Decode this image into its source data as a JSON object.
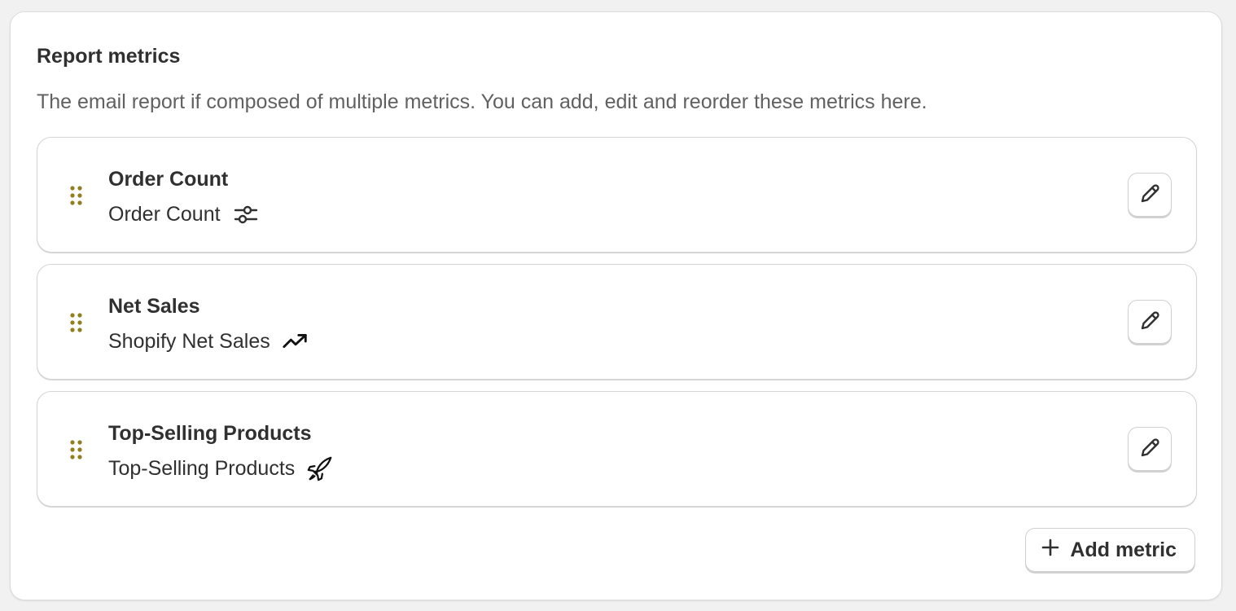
{
  "section": {
    "title": "Report metrics",
    "description": "The email report if composed of multiple metrics. You can add, edit and reorder these metrics here."
  },
  "metrics": [
    {
      "title": "Order Count",
      "subtitle": "Order Count",
      "icon": "sliders-icon"
    },
    {
      "title": "Net Sales",
      "subtitle": "Shopify Net Sales",
      "icon": "trend-up-icon"
    },
    {
      "title": "Top-Selling Products",
      "subtitle": "Top-Selling Products",
      "icon": "rocket-icon"
    }
  ],
  "actions": {
    "add_metric_label": "Add metric"
  },
  "colors": {
    "drag_handle": "#8f7f1f",
    "text": "#303030",
    "muted_text": "#616161"
  }
}
